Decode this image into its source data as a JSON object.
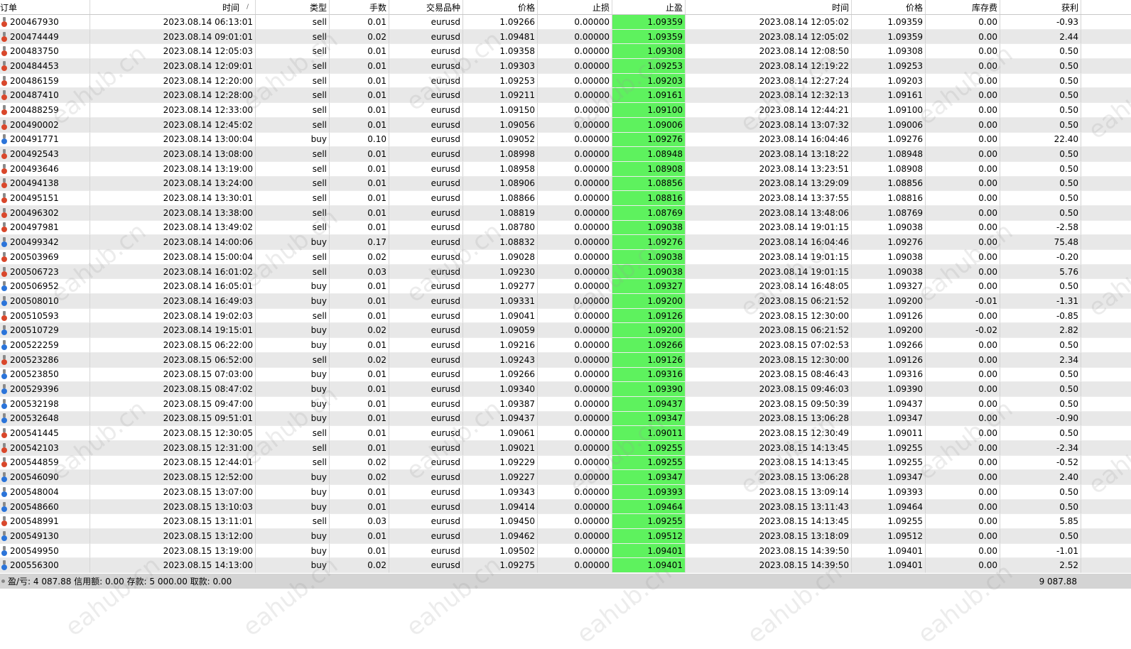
{
  "columns": [
    "订单",
    "时间",
    "类型",
    "手数",
    "交易品种",
    "价格",
    "止损",
    "止盈",
    "时间",
    "价格",
    "库存费",
    "获利"
  ],
  "sort_indicator": "/",
  "colors": {
    "take_profit_bg": "#5ef25e",
    "row_alt": "#e8e8e8",
    "footer_bg": "#d4d4d4"
  },
  "rows": [
    [
      "200467930",
      "2023.08.14 06:13:01",
      "sell",
      "0.01",
      "eurusd",
      "1.09266",
      "0.00000",
      "1.09359",
      "2023.08.14 12:05:02",
      "1.09359",
      "0.00",
      "-0.93"
    ],
    [
      "200474449",
      "2023.08.14 09:01:01",
      "sell",
      "0.02",
      "eurusd",
      "1.09481",
      "0.00000",
      "1.09359",
      "2023.08.14 12:05:02",
      "1.09359",
      "0.00",
      "2.44"
    ],
    [
      "200483750",
      "2023.08.14 12:05:03",
      "sell",
      "0.01",
      "eurusd",
      "1.09358",
      "0.00000",
      "1.09308",
      "2023.08.14 12:08:50",
      "1.09308",
      "0.00",
      "0.50"
    ],
    [
      "200484453",
      "2023.08.14 12:09:01",
      "sell",
      "0.01",
      "eurusd",
      "1.09303",
      "0.00000",
      "1.09253",
      "2023.08.14 12:19:22",
      "1.09253",
      "0.00",
      "0.50"
    ],
    [
      "200486159",
      "2023.08.14 12:20:00",
      "sell",
      "0.01",
      "eurusd",
      "1.09253",
      "0.00000",
      "1.09203",
      "2023.08.14 12:27:24",
      "1.09203",
      "0.00",
      "0.50"
    ],
    [
      "200487410",
      "2023.08.14 12:28:00",
      "sell",
      "0.01",
      "eurusd",
      "1.09211",
      "0.00000",
      "1.09161",
      "2023.08.14 12:32:13",
      "1.09161",
      "0.00",
      "0.50"
    ],
    [
      "200488259",
      "2023.08.14 12:33:00",
      "sell",
      "0.01",
      "eurusd",
      "1.09150",
      "0.00000",
      "1.09100",
      "2023.08.14 12:44:21",
      "1.09100",
      "0.00",
      "0.50"
    ],
    [
      "200490002",
      "2023.08.14 12:45:02",
      "sell",
      "0.01",
      "eurusd",
      "1.09056",
      "0.00000",
      "1.09006",
      "2023.08.14 13:07:32",
      "1.09006",
      "0.00",
      "0.50"
    ],
    [
      "200491771",
      "2023.08.14 13:00:04",
      "buy",
      "0.10",
      "eurusd",
      "1.09052",
      "0.00000",
      "1.09276",
      "2023.08.14 16:04:46",
      "1.09276",
      "0.00",
      "22.40"
    ],
    [
      "200492543",
      "2023.08.14 13:08:00",
      "sell",
      "0.01",
      "eurusd",
      "1.08998",
      "0.00000",
      "1.08948",
      "2023.08.14 13:18:22",
      "1.08948",
      "0.00",
      "0.50"
    ],
    [
      "200493646",
      "2023.08.14 13:19:00",
      "sell",
      "0.01",
      "eurusd",
      "1.08958",
      "0.00000",
      "1.08908",
      "2023.08.14 13:23:51",
      "1.08908",
      "0.00",
      "0.50"
    ],
    [
      "200494138",
      "2023.08.14 13:24:00",
      "sell",
      "0.01",
      "eurusd",
      "1.08906",
      "0.00000",
      "1.08856",
      "2023.08.14 13:29:09",
      "1.08856",
      "0.00",
      "0.50"
    ],
    [
      "200495151",
      "2023.08.14 13:30:01",
      "sell",
      "0.01",
      "eurusd",
      "1.08866",
      "0.00000",
      "1.08816",
      "2023.08.14 13:37:55",
      "1.08816",
      "0.00",
      "0.50"
    ],
    [
      "200496302",
      "2023.08.14 13:38:00",
      "sell",
      "0.01",
      "eurusd",
      "1.08819",
      "0.00000",
      "1.08769",
      "2023.08.14 13:48:06",
      "1.08769",
      "0.00",
      "0.50"
    ],
    [
      "200497981",
      "2023.08.14 13:49:02",
      "sell",
      "0.01",
      "eurusd",
      "1.08780",
      "0.00000",
      "1.09038",
      "2023.08.14 19:01:15",
      "1.09038",
      "0.00",
      "-2.58"
    ],
    [
      "200499342",
      "2023.08.14 14:00:06",
      "buy",
      "0.17",
      "eurusd",
      "1.08832",
      "0.00000",
      "1.09276",
      "2023.08.14 16:04:46",
      "1.09276",
      "0.00",
      "75.48"
    ],
    [
      "200503969",
      "2023.08.14 15:00:04",
      "sell",
      "0.02",
      "eurusd",
      "1.09028",
      "0.00000",
      "1.09038",
      "2023.08.14 19:01:15",
      "1.09038",
      "0.00",
      "-0.20"
    ],
    [
      "200506723",
      "2023.08.14 16:01:02",
      "sell",
      "0.03",
      "eurusd",
      "1.09230",
      "0.00000",
      "1.09038",
      "2023.08.14 19:01:15",
      "1.09038",
      "0.00",
      "5.76"
    ],
    [
      "200506952",
      "2023.08.14 16:05:01",
      "buy",
      "0.01",
      "eurusd",
      "1.09277",
      "0.00000",
      "1.09327",
      "2023.08.14 16:48:05",
      "1.09327",
      "0.00",
      "0.50"
    ],
    [
      "200508010",
      "2023.08.14 16:49:03",
      "buy",
      "0.01",
      "eurusd",
      "1.09331",
      "0.00000",
      "1.09200",
      "2023.08.15 06:21:52",
      "1.09200",
      "-0.01",
      "-1.31"
    ],
    [
      "200510593",
      "2023.08.14 19:02:03",
      "sell",
      "0.01",
      "eurusd",
      "1.09041",
      "0.00000",
      "1.09126",
      "2023.08.15 12:30:00",
      "1.09126",
      "0.00",
      "-0.85"
    ],
    [
      "200510729",
      "2023.08.14 19:15:01",
      "buy",
      "0.02",
      "eurusd",
      "1.09059",
      "0.00000",
      "1.09200",
      "2023.08.15 06:21:52",
      "1.09200",
      "-0.02",
      "2.82"
    ],
    [
      "200522259",
      "2023.08.15 06:22:00",
      "buy",
      "0.01",
      "eurusd",
      "1.09216",
      "0.00000",
      "1.09266",
      "2023.08.15 07:02:53",
      "1.09266",
      "0.00",
      "0.50"
    ],
    [
      "200523286",
      "2023.08.15 06:52:00",
      "sell",
      "0.02",
      "eurusd",
      "1.09243",
      "0.00000",
      "1.09126",
      "2023.08.15 12:30:00",
      "1.09126",
      "0.00",
      "2.34"
    ],
    [
      "200523850",
      "2023.08.15 07:03:00",
      "buy",
      "0.01",
      "eurusd",
      "1.09266",
      "0.00000",
      "1.09316",
      "2023.08.15 08:46:43",
      "1.09316",
      "0.00",
      "0.50"
    ],
    [
      "200529396",
      "2023.08.15 08:47:02",
      "buy",
      "0.01",
      "eurusd",
      "1.09340",
      "0.00000",
      "1.09390",
      "2023.08.15 09:46:03",
      "1.09390",
      "0.00",
      "0.50"
    ],
    [
      "200532198",
      "2023.08.15 09:47:00",
      "buy",
      "0.01",
      "eurusd",
      "1.09387",
      "0.00000",
      "1.09437",
      "2023.08.15 09:50:39",
      "1.09437",
      "0.00",
      "0.50"
    ],
    [
      "200532648",
      "2023.08.15 09:51:01",
      "buy",
      "0.01",
      "eurusd",
      "1.09437",
      "0.00000",
      "1.09347",
      "2023.08.15 13:06:28",
      "1.09347",
      "0.00",
      "-0.90"
    ],
    [
      "200541445",
      "2023.08.15 12:30:05",
      "sell",
      "0.01",
      "eurusd",
      "1.09061",
      "0.00000",
      "1.09011",
      "2023.08.15 12:30:49",
      "1.09011",
      "0.00",
      "0.50"
    ],
    [
      "200542103",
      "2023.08.15 12:31:00",
      "sell",
      "0.01",
      "eurusd",
      "1.09021",
      "0.00000",
      "1.09255",
      "2023.08.15 14:13:45",
      "1.09255",
      "0.00",
      "-2.34"
    ],
    [
      "200544859",
      "2023.08.15 12:44:01",
      "sell",
      "0.02",
      "eurusd",
      "1.09229",
      "0.00000",
      "1.09255",
      "2023.08.15 14:13:45",
      "1.09255",
      "0.00",
      "-0.52"
    ],
    [
      "200546090",
      "2023.08.15 12:52:00",
      "buy",
      "0.02",
      "eurusd",
      "1.09227",
      "0.00000",
      "1.09347",
      "2023.08.15 13:06:28",
      "1.09347",
      "0.00",
      "2.40"
    ],
    [
      "200548004",
      "2023.08.15 13:07:00",
      "buy",
      "0.01",
      "eurusd",
      "1.09343",
      "0.00000",
      "1.09393",
      "2023.08.15 13:09:14",
      "1.09393",
      "0.00",
      "0.50"
    ],
    [
      "200548660",
      "2023.08.15 13:10:03",
      "buy",
      "0.01",
      "eurusd",
      "1.09414",
      "0.00000",
      "1.09464",
      "2023.08.15 13:11:43",
      "1.09464",
      "0.00",
      "0.50"
    ],
    [
      "200548991",
      "2023.08.15 13:11:01",
      "sell",
      "0.03",
      "eurusd",
      "1.09450",
      "0.00000",
      "1.09255",
      "2023.08.15 14:13:45",
      "1.09255",
      "0.00",
      "5.85"
    ],
    [
      "200549130",
      "2023.08.15 13:12:00",
      "buy",
      "0.01",
      "eurusd",
      "1.09462",
      "0.00000",
      "1.09512",
      "2023.08.15 13:18:09",
      "1.09512",
      "0.00",
      "0.50"
    ],
    [
      "200549950",
      "2023.08.15 13:19:00",
      "buy",
      "0.01",
      "eurusd",
      "1.09502",
      "0.00000",
      "1.09401",
      "2023.08.15 14:39:50",
      "1.09401",
      "0.00",
      "-1.01"
    ],
    [
      "200556300",
      "2023.08.15 14:13:00",
      "buy",
      "0.02",
      "eurusd",
      "1.09275",
      "0.00000",
      "1.09401",
      "2023.08.15 14:39:50",
      "1.09401",
      "0.00",
      "2.52"
    ]
  ],
  "footer": {
    "summary": "盈/亏: 4 087.88  信用额: 0.00  存款: 5 000.00  取款: 0.00",
    "total_profit": "9 087.88"
  },
  "watermark": "eahub.cn"
}
